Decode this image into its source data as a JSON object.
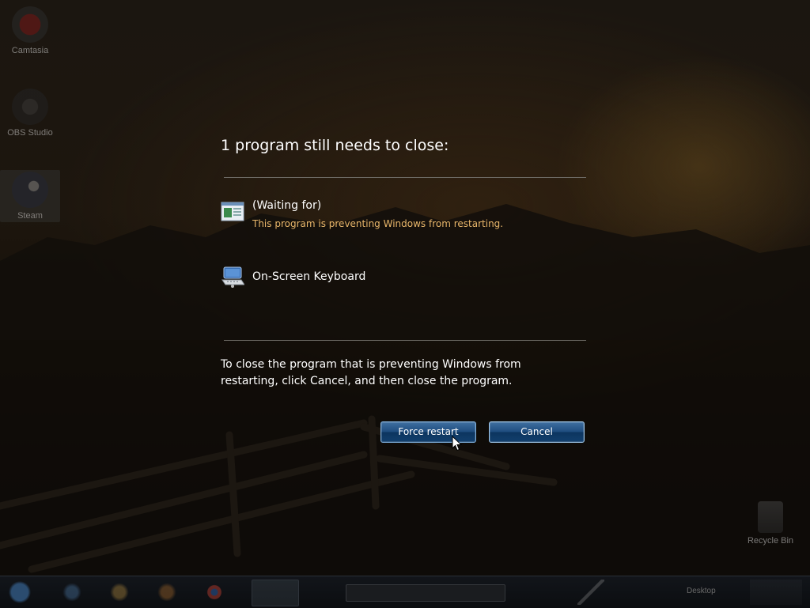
{
  "colors": {
    "accent_button": "#1f4d7f",
    "warning_text": "#e8b66a",
    "rule": "#6c6963"
  },
  "desktop": {
    "icons": [
      {
        "label": "Camtasia",
        "icon": "record-icon"
      },
      {
        "label": "OBS Studio",
        "icon": "obs-icon"
      },
      {
        "label": "Steam",
        "icon": "steam-icon"
      },
      {
        "label": "Recycle Bin",
        "icon": "recycle-bin-icon"
      }
    ]
  },
  "dialog": {
    "title": "1 program still needs to close:",
    "programs": [
      {
        "name": "(Waiting for)",
        "description": "This program is preventing Windows from restarting.",
        "icon": "window-app-icon"
      },
      {
        "name": "On-Screen Keyboard",
        "description": "",
        "icon": "keyboard-icon"
      }
    ],
    "message": "To close the program that is preventing Windows from restarting, click Cancel, and then close the program.",
    "buttons": {
      "force_restart": "Force restart",
      "cancel": "Cancel"
    }
  },
  "taskbar": {
    "items": [
      "start-orb-icon",
      "explorer-icon",
      "folder-icon",
      "media-icon",
      "chrome-icon",
      "app-icon"
    ],
    "search_placeholder": "",
    "tray_text": "Desktop"
  }
}
